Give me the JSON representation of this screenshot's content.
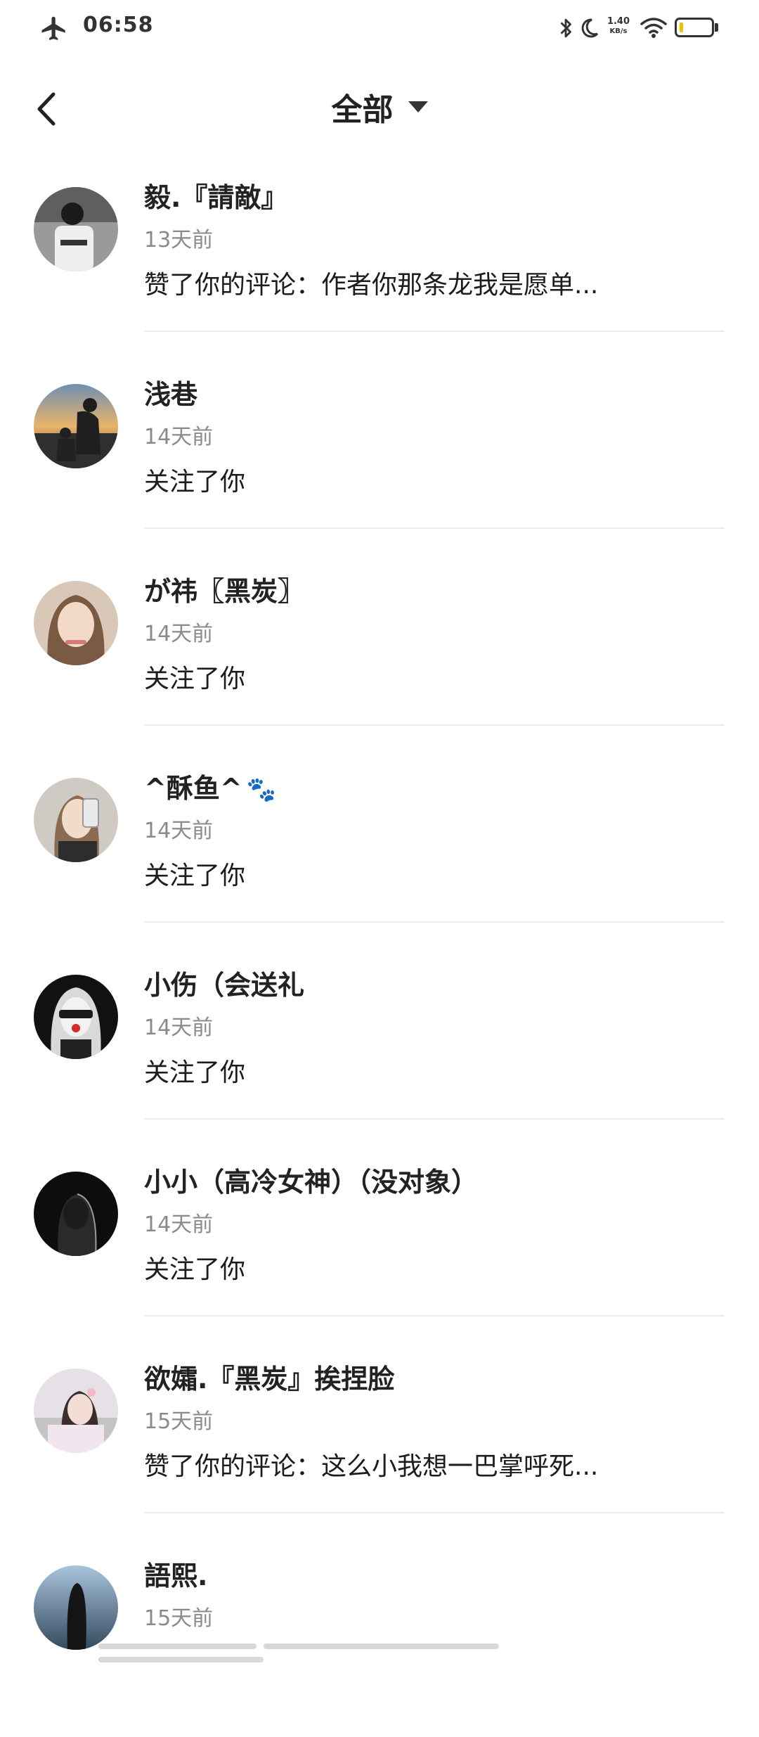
{
  "status_bar": {
    "time": "06:58",
    "net_speed_value": "1.40",
    "net_speed_unit": "KB/s",
    "icons": [
      "airplane-icon",
      "bluetooth-icon",
      "moon-icon",
      "wifi-icon",
      "battery-icon"
    ]
  },
  "header": {
    "title": "全部",
    "icons": [
      "back-icon",
      "caret-down-icon"
    ]
  },
  "notifications": [
    {
      "name": "毅.『請敵』",
      "time": "13天前",
      "action": "赞了你的评论：作者你那条龙我是愿单..."
    },
    {
      "name": "浅巷",
      "time": "14天前",
      "action": "关注了你"
    },
    {
      "name": "が祎〖黑炭〗",
      "time": "14天前",
      "action": "关注了你"
    },
    {
      "name": "^酥鱼^",
      "time": "14天前",
      "action": "关注了你",
      "emoji": "🐾"
    },
    {
      "name": "小伤（会送礼",
      "time": "14天前",
      "action": "关注了你"
    },
    {
      "name": "小小（高冷女神）（没对象）",
      "time": "14天前",
      "action": "关注了你"
    },
    {
      "name": "欲孀.『黑炭』挨捏脸",
      "time": "15天前",
      "action": "赞了你的评论：这么小我想一巴掌呼死..."
    },
    {
      "name": "語熙.",
      "time": "15天前",
      "action": ""
    }
  ],
  "colors": {
    "background": "#ffffff",
    "text_primary": "#1b1b1b",
    "text_secondary": "#8a8a8a",
    "divider": "#ececec",
    "battery_fill": "#e6c200"
  }
}
